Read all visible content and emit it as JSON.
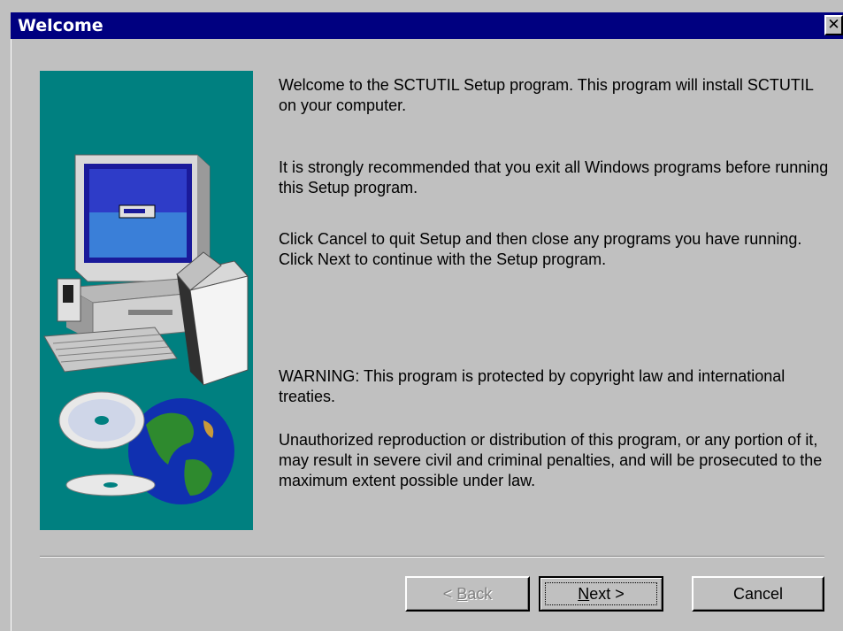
{
  "window": {
    "title": "Welcome",
    "close_glyph": "✕"
  },
  "graphic": {
    "icon": "setup-illustration-computer-cd-globe"
  },
  "body": {
    "para1": "Welcome to the SCTUTIL Setup program.  This program will install SCTUTIL on your computer.",
    "para2": "It is strongly recommended that you exit all Windows programs before running this Setup program.",
    "para3": "Click Cancel to quit Setup and then close any programs you have running.  Click Next to continue with the Setup program.",
    "para4": "WARNING: This program is protected by copyright law and international treaties.",
    "para5": "Unauthorized reproduction or distribution of this program, or any portion of it, may result in severe civil and criminal penalties, and will be prosecuted to the maximum extent possible under law."
  },
  "buttons": {
    "back": {
      "prefix": "< ",
      "mnemonic": "B",
      "rest": "ack"
    },
    "next": {
      "mnemonic": "N",
      "rest": "ext >"
    },
    "cancel": "Cancel"
  },
  "colors": {
    "titlebar": "#000080",
    "panel": "#c0c0c0",
    "graphic_bg": "#008080"
  }
}
